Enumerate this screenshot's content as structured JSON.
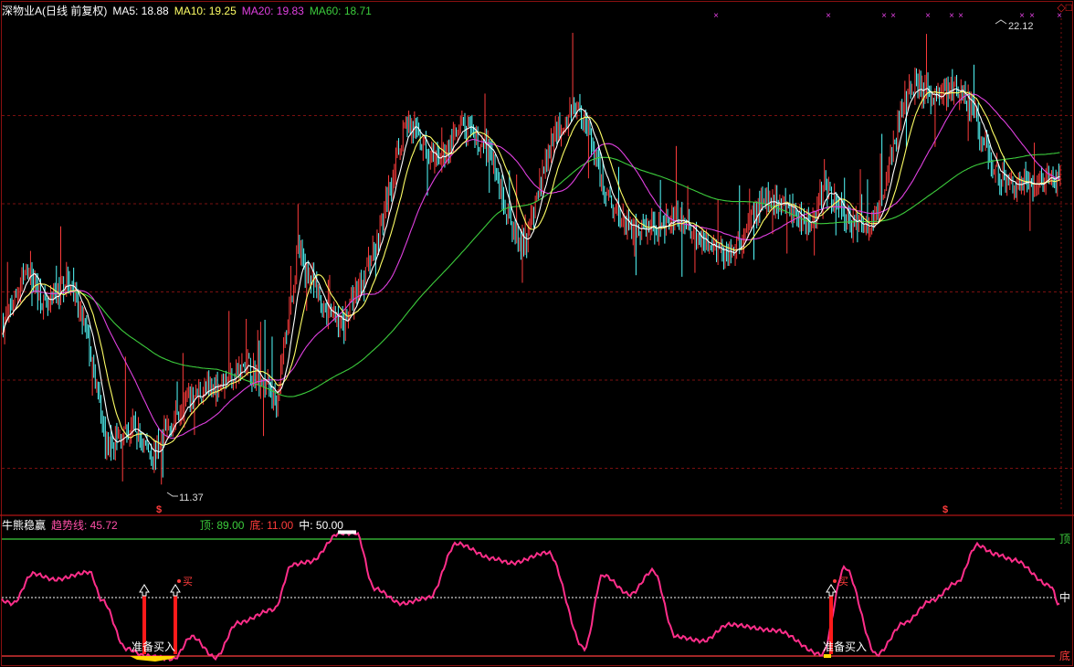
{
  "top_header": {
    "stock_name": "深物业A(日线 前复权)",
    "ma5_label": "MA5: 18.88",
    "ma10_label": "MA10: 19.25",
    "ma20_label": "MA20: 19.83",
    "ma60_label": "MA60: 18.71",
    "colors": {
      "name": "#ffffff",
      "ma5": "#ffffff",
      "ma10": "#ffff66",
      "ma20": "#e040e0",
      "ma60": "#3ccc3c"
    }
  },
  "window_controls": "◇□",
  "bottom_header": {
    "indicator_name": "牛熊稳赢",
    "trend_label": "趋势线: 45.72",
    "top_label": "顶: 89.00",
    "bottom_label": "底: 11.00",
    "mid_label": "中: 50.00"
  },
  "chart_data": [
    {
      "type": "candlestick",
      "series_name": "深物业A(日线 前复权)",
      "price_range": [
        10.2,
        23.6
      ],
      "grid": true,
      "annotations": {
        "high_label": "22.12",
        "low_label": "11.37"
      },
      "markers": {
        "top_x_marks": 11,
        "bottom_dollar_marks": 2,
        "dollar": "$",
        "x": "×"
      },
      "colors": {
        "up": "#ff3c3c",
        "down": "#54ffff",
        "ma5": "#ffffff",
        "ma10": "#ffff66",
        "ma20": "#e040e0",
        "ma60": "#3ccc3c"
      },
      "lines": [
        "MA5",
        "MA10",
        "MA20",
        "MA60"
      ]
    },
    {
      "type": "line",
      "title": "牛熊稳赢",
      "series": [
        {
          "name": "趋势线",
          "last_value": 45.72
        }
      ],
      "reference_levels": [
        {
          "name": "顶",
          "value": 89.0,
          "color": "#3ccc3c"
        },
        {
          "name": "中",
          "value": 50.0,
          "color": "#ffffff"
        },
        {
          "name": "底",
          "value": 11.0,
          "color": "#ff3c3c"
        }
      ],
      "signals": [
        {
          "label": "准备买入",
          "buy_label": "买"
        },
        {
          "label": "准备买入",
          "buy_label": "买"
        }
      ]
    }
  ]
}
